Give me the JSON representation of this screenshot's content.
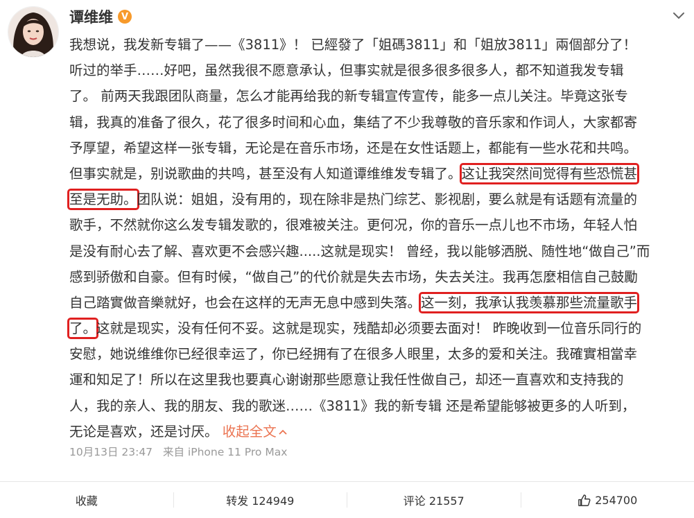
{
  "user": {
    "name": "谭维维",
    "verified_badge": "V"
  },
  "post": {
    "lines": [
      [
        "我想说，我发新专辑了——《3811》！ 已經發了「姐碼3811」和「姐放3811」兩個部分了！"
      ],
      [
        "听过的举手……好吧，虽然我很不愿意承认，但事实就是很多很多很多人，都不知道我发专辑"
      ],
      [
        "了。 前两天我跟团队商量，怎么才能再给我的新专辑宣传宣传，能多一点儿关注。毕竟这张专"
      ],
      [
        "辑，我真的准备了很久，花了很多时间和心血，集结了不少我尊敬的音乐家和作词人，大家都寄"
      ],
      [
        "予厚望，希望这样一张专辑，无论是在音乐市场，还是在女性话题上，都能有一些水花和共鸣。"
      ],
      [
        "但事实就是，别说歌曲的共鸣，甚至没有人知道谭维维发专辑了。",
        "这让我突然间觉得有些恐慌甚"
      ],
      [
        "至是无助。",
        "团队说：姐姐，没有用的，现在除非是热门综艺、影视剧，要么就是有话题有流量的"
      ],
      [
        "歌手，不然就你这么发专辑发歌的，很难被关注。更何况，你的音乐一点儿也不市场，年轻人怕"
      ],
      [
        "是没有耐心去了解、喜欢更不会感兴趣.....这就是现实！ 曾经，我以能够洒脱、随性地“做自己”而"
      ],
      [
        "感到骄傲和自豪。但有时候，“做自己”的代价就是失去市场，失去关注。我再怎麼相信自己鼓勵"
      ],
      [
        "自己踏實做音樂就好，也会在这样的无声无息中感到失落。",
        "这一刻，我承认我羡慕那些流量歌手"
      ],
      [
        "了。",
        "这就是现实，没有任何不妥。这就是现实，残酷却必须要去面对！ 昨晚收到一位音乐同行的"
      ],
      [
        "安慰，她说维维你已经很幸运了，你已经拥有了在很多人眼里，太多的爱和关注。我確實相當幸"
      ],
      [
        "運和知足了！所以在这里我也要真心谢谢那些愿意让我任性做自己，却还一直喜欢和支持我的"
      ],
      [
        "人，我的亲人、我的朋友、我的歌迷……",
        "《3811》",
        "我的新专辑 还是希望能够被更多的人听到，"
      ],
      [
        "无论是喜欢，还是讨厌。 "
      ]
    ],
    "collapse_label": "收起全文",
    "timestamp": "10月13日 23:47",
    "source": "来自 iPhone 11 Pro Max"
  },
  "footer": {
    "favorite_label": "收藏",
    "repost_label": "转发 124949",
    "comment_label": "评论 21557",
    "like_count": "254700"
  },
  "colors": {
    "highlight": "#e02020",
    "link": "#eb7350",
    "meta": "#999999"
  }
}
